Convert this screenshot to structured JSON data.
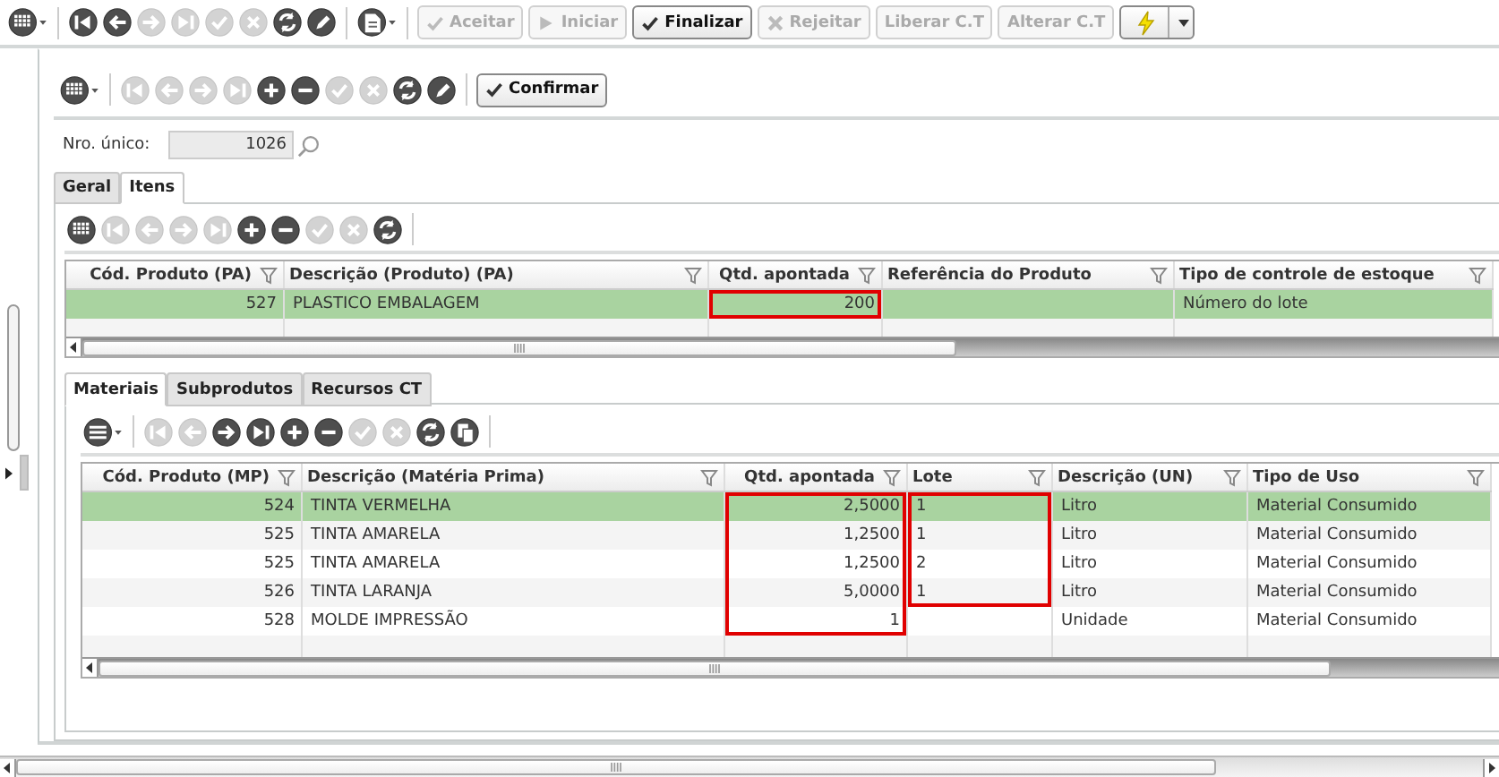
{
  "main_toolbar": {
    "tools": [
      {
        "kind": "grid-menu",
        "disabled": false
      },
      {
        "kind": "separator"
      },
      {
        "kind": "first",
        "disabled": false
      },
      {
        "kind": "prev",
        "disabled": false
      },
      {
        "kind": "next",
        "disabled": true
      },
      {
        "kind": "last",
        "disabled": true
      },
      {
        "kind": "confirm",
        "disabled": true
      },
      {
        "kind": "cancel",
        "disabled": true
      },
      {
        "kind": "refresh",
        "disabled": false
      },
      {
        "kind": "edit",
        "disabled": false
      },
      {
        "kind": "separator"
      },
      {
        "kind": "doc-menu",
        "disabled": false
      },
      {
        "kind": "separator"
      }
    ],
    "buttons": [
      {
        "label": "Aceitar",
        "kind": "check",
        "disabled": true
      },
      {
        "label": "Iniciar",
        "kind": "play",
        "disabled": true
      },
      {
        "label": "Finalizar",
        "kind": "check",
        "disabled": false
      },
      {
        "label": "Rejeitar",
        "kind": "cross",
        "disabled": true
      },
      {
        "label": "Liberar C.T",
        "kind": "text",
        "disabled": true
      },
      {
        "label": "Alterar C.T",
        "kind": "text",
        "disabled": true
      }
    ]
  },
  "form_toolbar": {
    "tools": [
      {
        "kind": "grid-menu",
        "disabled": false
      },
      {
        "kind": "separator"
      },
      {
        "kind": "first",
        "disabled": true
      },
      {
        "kind": "prev",
        "disabled": true
      },
      {
        "kind": "next",
        "disabled": true
      },
      {
        "kind": "last",
        "disabled": true
      },
      {
        "kind": "add",
        "disabled": false
      },
      {
        "kind": "remove",
        "disabled": false
      },
      {
        "kind": "confirm",
        "disabled": true
      },
      {
        "kind": "cancel",
        "disabled": true
      },
      {
        "kind": "refresh",
        "disabled": false
      },
      {
        "kind": "edit",
        "disabled": false
      },
      {
        "kind": "separator"
      }
    ],
    "buttons": [
      {
        "label": "Confirmar",
        "kind": "check",
        "disabled": false
      }
    ]
  },
  "record": {
    "label": "Nro. único:",
    "value": "1026"
  },
  "tabs": [
    {
      "label": "Geral",
      "selected": false
    },
    {
      "label": "Itens",
      "selected": true
    }
  ],
  "items": {
    "tools": [
      {
        "kind": "grid",
        "disabled": false
      },
      {
        "kind": "first",
        "disabled": true
      },
      {
        "kind": "prev",
        "disabled": true
      },
      {
        "kind": "next",
        "disabled": true
      },
      {
        "kind": "last",
        "disabled": true
      },
      {
        "kind": "add",
        "disabled": false
      },
      {
        "kind": "remove",
        "disabled": false
      },
      {
        "kind": "confirm",
        "disabled": true
      },
      {
        "kind": "cancel",
        "disabled": true
      },
      {
        "kind": "refresh",
        "disabled": false
      },
      {
        "kind": "separator"
      }
    ],
    "table": {
      "columns": [
        {
          "label": "Cód. Produto (PA)"
        },
        {
          "label": "Descrição (Produto) (PA)"
        },
        {
          "label": "Qtd. apontada"
        },
        {
          "label": "Referência do Produto"
        },
        {
          "label": "Tipo de controle de estoque"
        }
      ],
      "rows": [
        {
          "selected": true,
          "cells": [
            "527",
            "PLASTICO EMBALAGEM",
            "200",
            "",
            "Número do lote"
          ],
          "marked": [
            false,
            false,
            true,
            false,
            false
          ]
        }
      ]
    }
  },
  "sub_tabs": [
    {
      "label": "Materiais",
      "selected": true
    },
    {
      "label": "Subprodutos",
      "selected": false
    },
    {
      "label": "Recursos CT",
      "selected": false
    }
  ],
  "materials": {
    "tools": [
      {
        "kind": "list-menu",
        "disabled": false
      },
      {
        "kind": "separator"
      },
      {
        "kind": "first",
        "disabled": true
      },
      {
        "kind": "prev",
        "disabled": true
      },
      {
        "kind": "next",
        "disabled": false
      },
      {
        "kind": "last",
        "disabled": false
      },
      {
        "kind": "add",
        "disabled": false
      },
      {
        "kind": "remove",
        "disabled": false
      },
      {
        "kind": "confirm",
        "disabled": true
      },
      {
        "kind": "cancel",
        "disabled": true
      },
      {
        "kind": "refresh",
        "disabled": false
      },
      {
        "kind": "copy",
        "disabled": false
      },
      {
        "kind": "separator"
      }
    ],
    "table": {
      "columns": [
        {
          "label": "Cód. Produto (MP)"
        },
        {
          "label": "Descrição (Matéria Prima)"
        },
        {
          "label": "Qtd. apontada"
        },
        {
          "label": "Lote"
        },
        {
          "label": "Descrição (UN)"
        },
        {
          "label": "Tipo de Uso"
        }
      ],
      "rows": [
        {
          "selected": true,
          "cells": [
            "524",
            "TINTA VERMELHA",
            "2,5000",
            "1",
            "Litro",
            "Material Consumido"
          ],
          "marked": [
            false,
            false,
            true,
            true,
            false,
            false
          ]
        },
        {
          "selected": false,
          "cells": [
            "525",
            "TINTA AMARELA",
            "1,2500",
            "1",
            "Litro",
            "Material Consumido"
          ],
          "marked": [
            false,
            false,
            true,
            true,
            false,
            false
          ]
        },
        {
          "selected": false,
          "cells": [
            "525",
            "TINTA AMARELA",
            "1,2500",
            "2",
            "Litro",
            "Material Consumido"
          ],
          "marked": [
            false,
            false,
            true,
            true,
            false,
            false
          ]
        },
        {
          "selected": false,
          "cells": [
            "526",
            "TINTA LARANJA",
            "5,0000",
            "1",
            "Litro",
            "Material Consumido"
          ],
          "marked": [
            false,
            false,
            true,
            true,
            false,
            false
          ]
        },
        {
          "selected": false,
          "cells": [
            "528",
            "MOLDE IMPRESSÃO",
            "1",
            "",
            "Unidade",
            "Material Consumido"
          ],
          "marked": [
            false,
            false,
            true,
            false,
            false,
            false
          ]
        }
      ]
    }
  }
}
